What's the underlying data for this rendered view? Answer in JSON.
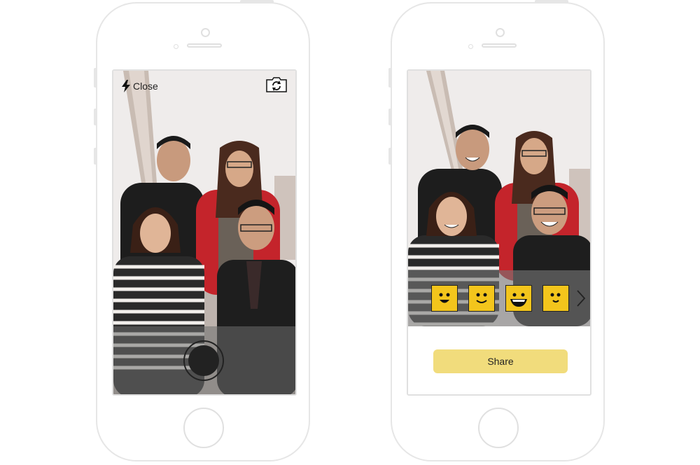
{
  "camera_screen": {
    "close_label": "Close",
    "flash_icon": "lightning-bolt",
    "switch_camera_icon": "camera-rotate",
    "shutter_icon": "record-circle"
  },
  "share_screen": {
    "emoji_icons": [
      "smiley-grin",
      "smiley-smile",
      "smiley-big-grin",
      "smiley-smirk"
    ],
    "next_icon": "chevron-right",
    "share_label": "Share"
  },
  "colors": {
    "emoji_yellow": "#f3c51c",
    "share_button": "#f1dc7c",
    "phone_outline": "#e6e6e6"
  }
}
